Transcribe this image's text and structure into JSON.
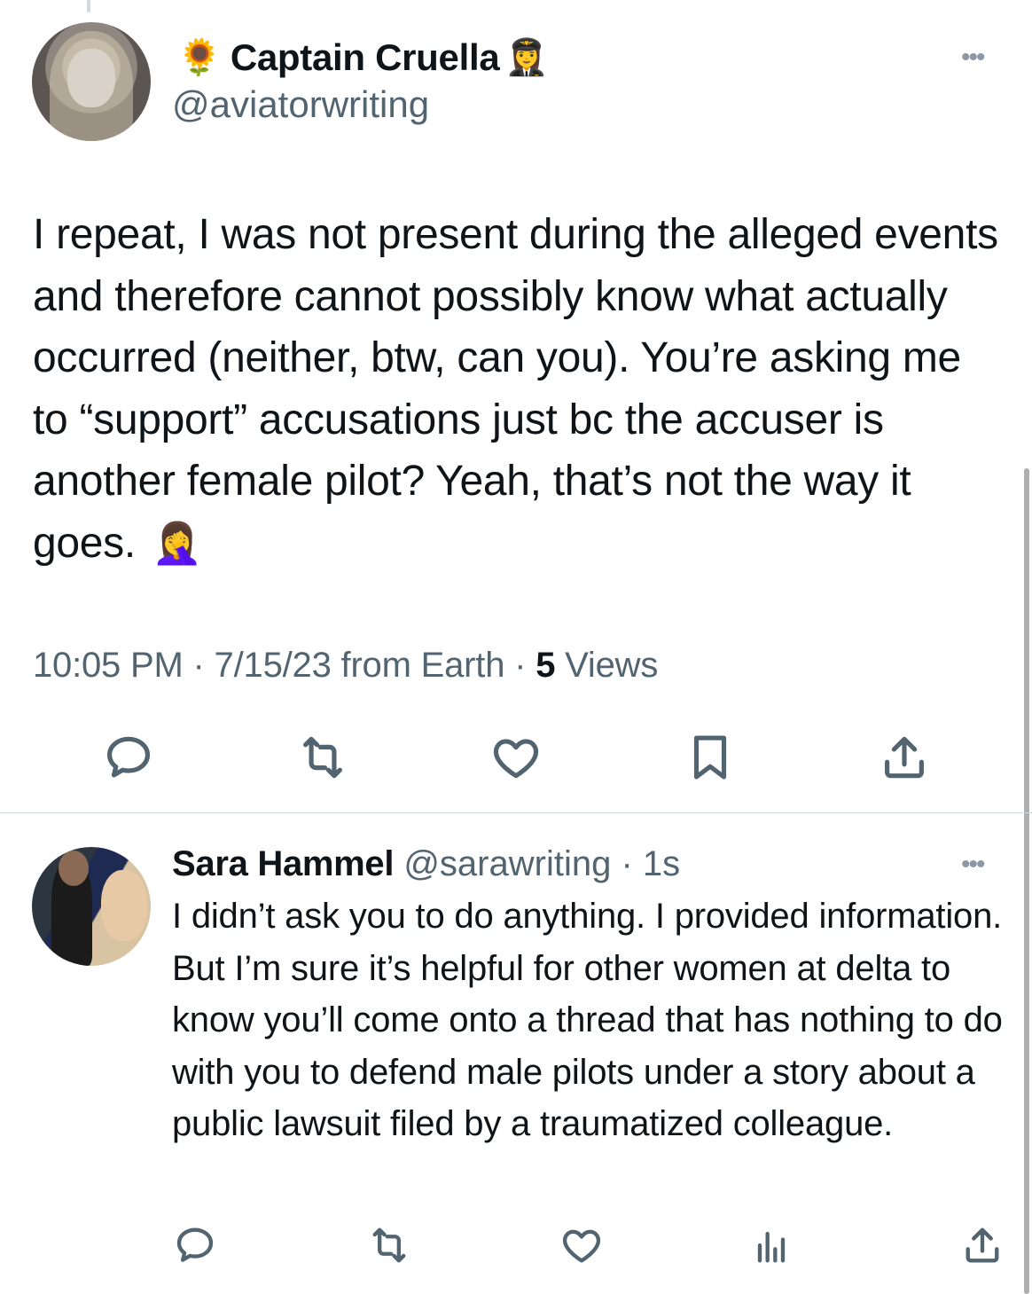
{
  "main_tweet": {
    "name_prefix_emoji": "🌻",
    "display_name": "Captain Cruella",
    "name_suffix_emoji": "👩‍✈️",
    "handle": "@aviatorwriting",
    "more_label": "•••",
    "text": "I repeat, I was not present during the alleged events and therefore cannot possibly know what actually occurred (neither, btw, can you). You’re asking me to “support” accusations just bc the accuser is another female pilot? Yeah, that’s not the way it goes.",
    "text_emoji": "🤦‍♀️",
    "timestamp": "10:05 PM · 7/15/23 from Earth · ",
    "views_count": "5",
    "views_label": " Views",
    "actions": [
      "reply-icon",
      "retweet-icon",
      "like-icon",
      "bookmark-icon",
      "share-icon"
    ]
  },
  "reply": {
    "display_name": "Sara Hammel",
    "handle": "@sarawriting",
    "time": " · 1s",
    "more_label": "•••",
    "text": "I didn’t ask you to do anything. I provided information. But I’m sure it’s helpful for other women at delta to know you’ll come onto a thread that has nothing to do with you to defend male pilots under a story about a public lawsuit filed by a traumatized colleague.",
    "actions": [
      "reply-icon",
      "retweet-icon",
      "like-icon",
      "views-icon",
      "share-icon"
    ]
  },
  "colors": {
    "text": "#0f1419",
    "secondary": "#536471",
    "divider": "#cfd9de"
  }
}
